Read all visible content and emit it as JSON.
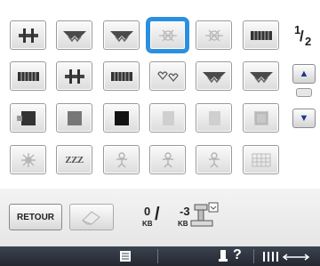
{
  "page_indicator": {
    "current": "1",
    "total": "2"
  },
  "scroll": {
    "up_icon": "triangle-up-icon",
    "down_icon": "triangle-down-icon"
  },
  "stitch_grid": {
    "rows": [
      [
        "bar-tack-stitch-icon",
        "satin-scallop-stitch-icon",
        "satin-scallop-stitch-icon",
        "cross-motif-stitch-icon",
        "cross-motif-stitch-icon",
        "bar-stitch-icon"
      ],
      [
        "bar-stitch-icon",
        "bar-tack-stitch-icon",
        "bar-stitch-icon",
        "heart-chain-stitch-icon",
        "satin-scallop-stitch-icon",
        "satin-scallop-stitch-icon"
      ],
      [
        "solid-fill-gray-icon",
        "solid-fill-dark-icon",
        "solid-fill-black-icon",
        "gray-flag-icon",
        "gray-flag-icon",
        "light-fill-icon"
      ],
      [
        "flower-stitch-icon",
        "zzz-stitch",
        "figure-motif-icon",
        "figure-motif-icon",
        "figure-motif-icon",
        "grid-stitch-icon"
      ]
    ],
    "zzz_label": "ZZZ",
    "selected": {
      "row": 0,
      "col": 3
    }
  },
  "controls": {
    "retour_label": "RETOUR",
    "eraser_icon": "eraser-icon",
    "memory_used": "0",
    "memory_used_unit": "KB",
    "memory_free": "-3",
    "memory_free_unit": "KB",
    "machine_icon": "sewing-machine-icon"
  },
  "bottom_bar": {
    "list_icon": "list-icon",
    "help_label": "?",
    "help_icon": "thread-spool-icon",
    "arrow_icon": "horizontal-arrow-icon"
  }
}
